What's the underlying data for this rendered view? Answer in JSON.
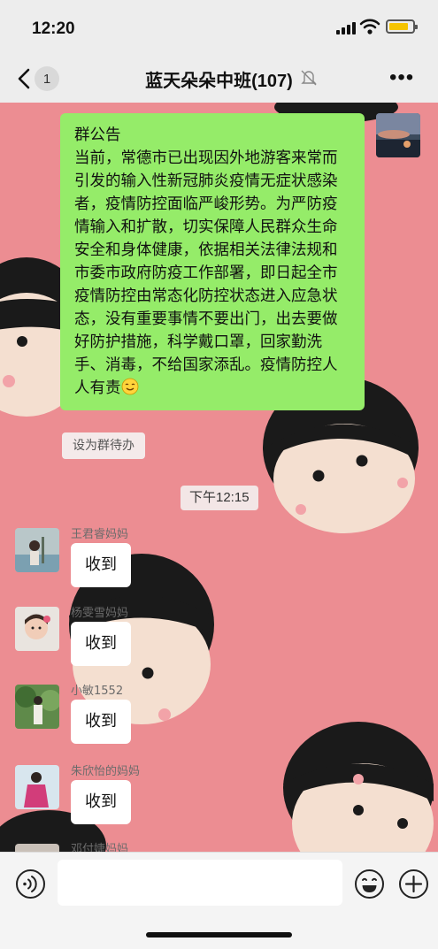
{
  "status_bar": {
    "time": "12:20"
  },
  "header": {
    "back_count": "1",
    "title": "蓝天朵朵中班(107)"
  },
  "announcement": {
    "heading": "群公告",
    "body": "当前，常德市已出现因外地游客来常而引发的输入性新冠肺炎疫情无症状感染者，疫情防控面临严峻形势。为严防疫情输入和扩散，切实保障人民群众生命安全和身体健康，依据相关法律法规和市委市政府防疫工作部署，即日起全市疫情防控由常态化防控状态进入应急状态，没有重要事情不要出门，出去要做好防护措施，科学戴口罩，回家勤洗手、消毒，不给国家添乱。疫情防控人人有责",
    "emoji_icon": "smiling-face-icon"
  },
  "todo_label": "设为群待办",
  "timestamp": "下午12:15",
  "messages": [
    {
      "sender": "王君睿妈妈",
      "text": "收到"
    },
    {
      "sender": "杨雯雪妈妈",
      "text": "收到"
    },
    {
      "sender": "小敏1552",
      "text": "收到"
    },
    {
      "sender": "朱欣怡的妈妈",
      "text": "收到"
    },
    {
      "sender": "邓付婕妈妈",
      "text": ""
    }
  ],
  "colors": {
    "chat_bg": "#ec8d92",
    "announcement_bubble": "#95ec69",
    "bar_bg": "#ededed"
  }
}
